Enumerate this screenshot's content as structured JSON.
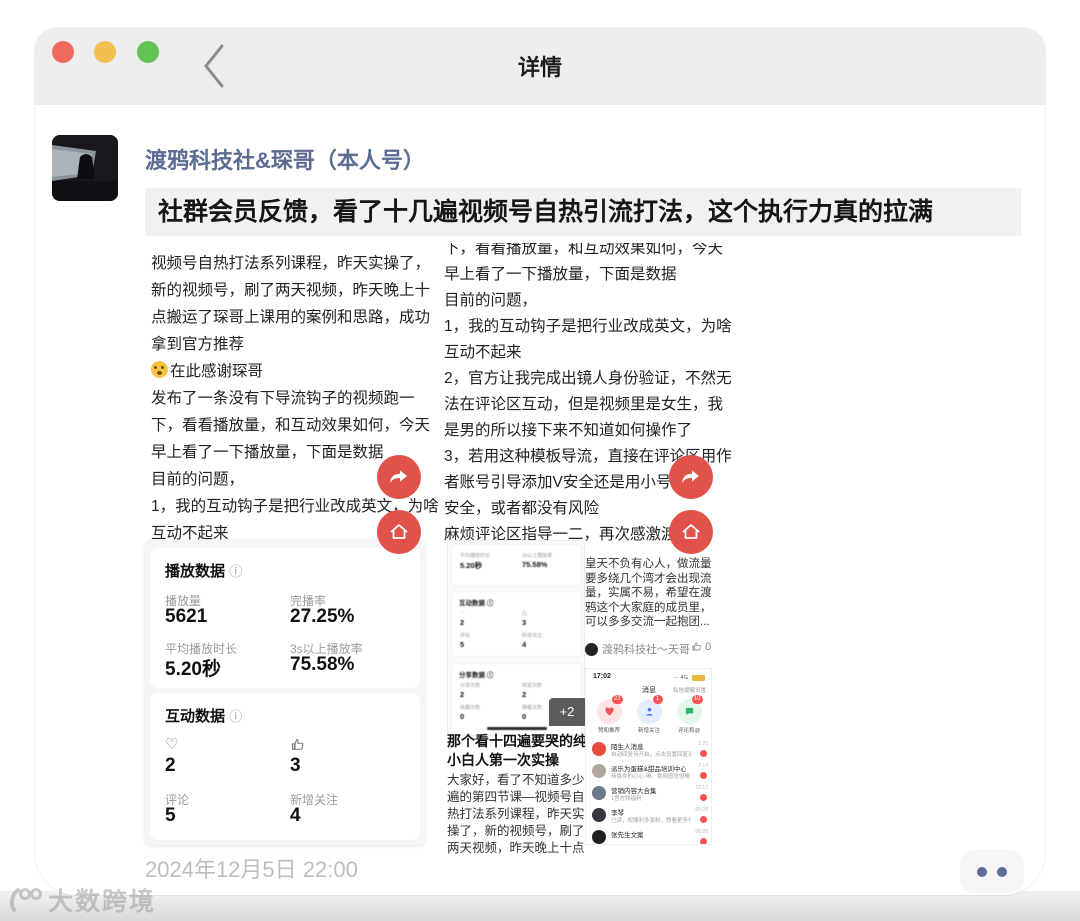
{
  "window": {
    "title": "详情"
  },
  "post": {
    "author": "渡鸦科技社&琛哥（本人号）",
    "headline": "社群会员反馈，看了十几遍视频号自热引流打法，这个执行力真的拉满",
    "page1_lines": [
      "视频号自热打法系列课程，昨天实操了，",
      "新的视频号，刷了两天视频，昨天晚上十",
      "点搬运了琛哥上课用的案例和思路，成功",
      "拿到官方推荐",
      "在此感谢琛哥",
      "发布了一条没有下导流钩子的视频跑一",
      "下，看看播放量，和互动效果如何，今天",
      "早上看了一下播放量，下面是数据",
      "目前的问题，",
      "1，我的互动钩子是把行业改成英文，为啥",
      "互动不起来"
    ],
    "page2_lines": [
      "下，看看播放量，和互动效果如何，今天",
      "早上看了一下播放量，下面是数据",
      "目前的问题，",
      "1，我的互动钩子是把行业改成英文，为啥",
      "互动不起来",
      "2，官方让我完成出镜人身份验证，不然无",
      "法在评论区互动，但是视频里是女生，我",
      "是男的所以接下来不知道如何操作了",
      "3，若用这种模板导流，直接在评论区用作",
      "者账号引导添加V安全还是用小号引导",
      "安全，或者都没有风险",
      "麻烦评论区指导一二，再次感激渡鸦"
    ]
  },
  "stats": {
    "play": {
      "title": "播放数据",
      "info_icon": "ⓘ",
      "m": [
        [
          "播放量",
          "5621"
        ],
        [
          "完播率",
          "27.25%"
        ],
        [
          "平均播放时长",
          "5.20秒"
        ],
        [
          "3s以上播放率",
          "75.58%"
        ]
      ]
    },
    "interact": {
      "title": "互动数据",
      "info_icon": "ⓘ",
      "heart_icon": "♡",
      "like_value": "2",
      "thumb_value": "3",
      "comment_label": "评论",
      "comment_value": "5",
      "follow_label": "新增关注",
      "follow_value": "4"
    }
  },
  "thumb": {
    "partial": [
      [
        "平均播放时长",
        "5.20秒"
      ],
      [
        "3s以上播放率",
        "75.58%"
      ]
    ],
    "interact": {
      "title": "互动数据 ⓘ",
      "m": [
        [
          "♡",
          "2"
        ],
        [
          "凸",
          "3"
        ],
        [
          "评论",
          "5"
        ],
        [
          "新增关注",
          "4"
        ]
      ]
    },
    "share": {
      "title": "分享数据 ⓘ",
      "m": [
        [
          "分享次数",
          "2"
        ],
        [
          "转发次数",
          "2"
        ],
        [
          "收藏次数",
          "0"
        ],
        [
          "弹幕次数",
          "0"
        ]
      ]
    },
    "more_badge": "+2",
    "title_l1": "那个看十四遍要哭的纯",
    "title_l2": "小白人第一次实操",
    "body_lines": [
      "大家好，看了不知道多少",
      "遍的第四节课—视频号自",
      "热打法系列课程，昨天实",
      "操了，新的视频号，刷了",
      "两天视频，昨天晚上十点"
    ]
  },
  "comment": {
    "lines": [
      "皇天不负有心人，做流量",
      "要多绕几个湾才会出现流",
      "量，实属不易，希望在渡",
      "鸦这个大家庭的成员里，",
      "可以多多交流一起抱团..."
    ],
    "author": "渡鸦科技社～天哥",
    "like_count": "0"
  },
  "messages": {
    "time": "17:02",
    "nav_title": "消息",
    "nav_right": "私信提醒设置",
    "shortcuts": [
      {
        "label": "赞和推荐",
        "badge": "23"
      },
      {
        "label": "新增关注",
        "badge": "1"
      },
      {
        "label": "评论和@",
        "badge": "10"
      }
    ],
    "items": [
      {
        "name": "陌生人消息",
        "preview": "自动回复待开启，点击设置回复语",
        "time": "1:25"
      },
      {
        "name": "派乐为蛋糕&甜品培训中心",
        "preview": "恭喜你的心心·琳，视频感觉很棒",
        "time": "7:14"
      },
      {
        "name": "营销内容大合集",
        "preview": "1官方领福利",
        "time": "12:17"
      },
      {
        "name": "李琴",
        "preview": "已读，祝顺利多涨粉，想看更多作品!",
        "time": "05:28"
      },
      {
        "name": "张先生文案",
        "preview": "",
        "time": "06:28"
      }
    ]
  },
  "footer": {
    "date": "2024年12月5日 22:00",
    "watermark": "大数跨境"
  },
  "colors": {
    "accent_red": "#e0524a",
    "link_blue": "#5b6b92",
    "badge_red": "#fa5151"
  }
}
